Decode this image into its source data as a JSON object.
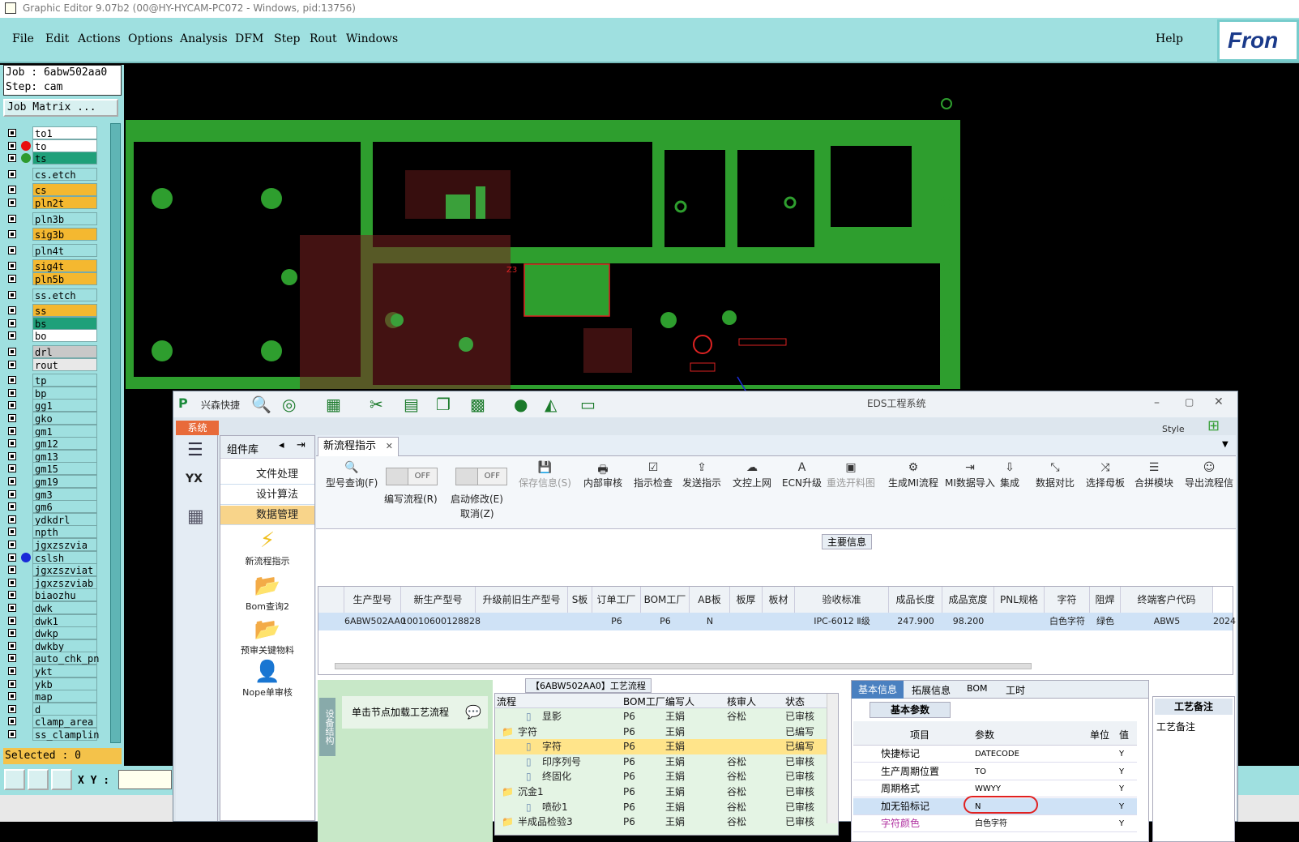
{
  "window_title": "Graphic Editor 9.07b2 (00@HY-HYCAM-PC072 - Windows, pid:13756)",
  "menu": [
    "File",
    "Edit",
    "Actions",
    "Options",
    "Analysis",
    "DFM",
    "Step",
    "Rout",
    "Windows"
  ],
  "help_label": "Help",
  "logo_text": "Fron",
  "job": {
    "job_line": "Job : 6abw502aa0",
    "step_line": "Step: cam",
    "matrix_button": "Job Matrix ..."
  },
  "layers": [
    {
      "name": "to1",
      "bg": "#ffffff"
    },
    {
      "name": "to",
      "bg": "#ffffff",
      "dot": "#e81010"
    },
    {
      "name": "ts",
      "bg": "#1fa07a",
      "dot": "#2e9a2e"
    },
    {
      "name": "cs.etch",
      "bg": "#9fe0e0"
    },
    {
      "name": "cs",
      "bg": "#f4b830"
    },
    {
      "name": "pln2t",
      "bg": "#f4b830"
    },
    {
      "name": "pln3b",
      "bg": "#9fe0e0"
    },
    {
      "name": "sig3b",
      "bg": "#f4b830"
    },
    {
      "name": "pln4t",
      "bg": "#9fe0e0"
    },
    {
      "name": "sig4t",
      "bg": "#f4b830"
    },
    {
      "name": "pln5b",
      "bg": "#f4b830"
    },
    {
      "name": "ss.etch",
      "bg": "#9fe0e0"
    },
    {
      "name": "ss",
      "bg": "#f4b830"
    },
    {
      "name": "bs",
      "bg": "#1fa07a"
    },
    {
      "name": "bo",
      "bg": "#ffffff"
    },
    {
      "name": "drl",
      "bg": "#c8c8c8"
    },
    {
      "name": "rout",
      "bg": "#e8e8e8"
    },
    {
      "name": "tp",
      "bg": "#9fe0e0"
    },
    {
      "name": "bp",
      "bg": "#9fe0e0"
    },
    {
      "name": "gg1",
      "bg": "#9fe0e0"
    },
    {
      "name": "gko",
      "bg": "#9fe0e0"
    },
    {
      "name": "gm1",
      "bg": "#9fe0e0"
    },
    {
      "name": "gm12",
      "bg": "#9fe0e0"
    },
    {
      "name": "gm13",
      "bg": "#9fe0e0"
    },
    {
      "name": "gm15",
      "bg": "#9fe0e0"
    },
    {
      "name": "gm19",
      "bg": "#9fe0e0"
    },
    {
      "name": "gm3",
      "bg": "#9fe0e0"
    },
    {
      "name": "gm6",
      "bg": "#9fe0e0"
    },
    {
      "name": "ydkdrl",
      "bg": "#9fe0e0"
    },
    {
      "name": "npth",
      "bg": "#9fe0e0"
    },
    {
      "name": "jgxzszvia",
      "bg": "#9fe0e0"
    },
    {
      "name": "cslsh",
      "bg": "#9fe0e0",
      "dot": "#1a2ad8"
    },
    {
      "name": "jgxzszviat",
      "bg": "#9fe0e0"
    },
    {
      "name": "jgxzszviab",
      "bg": "#9fe0e0"
    },
    {
      "name": "biaozhu",
      "bg": "#9fe0e0"
    },
    {
      "name": "dwk",
      "bg": "#9fe0e0"
    },
    {
      "name": "dwk1",
      "bg": "#9fe0e0"
    },
    {
      "name": "dwkp",
      "bg": "#9fe0e0"
    },
    {
      "name": "dwkby",
      "bg": "#9fe0e0"
    },
    {
      "name": "auto_chk_pn",
      "bg": "#9fe0e0"
    },
    {
      "name": "ykt",
      "bg": "#9fe0e0"
    },
    {
      "name": "ykb",
      "bg": "#9fe0e0"
    },
    {
      "name": "map",
      "bg": "#9fe0e0"
    },
    {
      "name": "d",
      "bg": "#9fe0e0"
    },
    {
      "name": "clamp_area",
      "bg": "#9fe0e0"
    },
    {
      "name": "ss_clamplin",
      "bg": "#9fe0e0"
    }
  ],
  "selected_text": "Selected : 0",
  "xy_label": "X Y :",
  "pcb_label": "Z3",
  "eds": {
    "app_name": "兴森快捷",
    "title": "EDS工程系统",
    "style_label": "Style",
    "system_tab": "系统",
    "component_lib": "组件库",
    "components": [
      "文件处理",
      "设计算法",
      "数据管理"
    ],
    "big_items": [
      "新流程指示",
      "Bom查询2",
      "预审关键物料",
      "Nope单审核"
    ],
    "doc_tab": "新流程指示",
    "ribbon": [
      {
        "label": "型号查询(F)",
        "icon": "🔍"
      },
      {
        "label": "保存信息(S)",
        "icon": "💾",
        "disabled": true
      },
      {
        "label": "内部审核",
        "icon": "🖶"
      },
      {
        "label": "指示检查",
        "icon": "☑"
      },
      {
        "label": "发送指示",
        "icon": "⇪"
      },
      {
        "label": "文控上网",
        "icon": "☁"
      },
      {
        "label": "ECN升级",
        "icon": "A"
      },
      {
        "label": "重选开料图",
        "icon": "▣",
        "disabled": true
      },
      {
        "label": "生成MI流程",
        "icon": "⚙"
      },
      {
        "label": "MI数据导入",
        "icon": "⇥"
      },
      {
        "label": "集成",
        "icon": "⇩"
      },
      {
        "label": "数据对比",
        "icon": "⤡"
      },
      {
        "label": "选择母板",
        "icon": "⤨"
      },
      {
        "label": "合拼模块",
        "icon": "☰"
      },
      {
        "label": "导出流程信",
        "icon": "☺"
      }
    ],
    "toggle1": {
      "state": "OFF",
      "label": "编写流程(R)"
    },
    "toggle2": {
      "state": "OFF",
      "label": "启动修改(E)",
      "sub": "取消(Z)"
    },
    "section_main": "主要信息",
    "grid_headers": [
      "生产型号",
      "新生产型号",
      "升级前旧生产型号",
      "S板",
      "订单工厂",
      "BOM工厂",
      "AB板",
      "板厚",
      "板材",
      "验收标准",
      "成品长度",
      "成品宽度",
      "PNL规格",
      "字符",
      "阻焊",
      "终端客户代码"
    ],
    "grid_row": [
      "6ABW502AA0",
      "10010600128828",
      "",
      "",
      "P6",
      "P6",
      "N",
      "",
      "",
      "IPC-6012 Ⅱ级",
      "247.900",
      "98.200",
      "",
      "白色字符",
      "绿色",
      "ABW5",
      "2024"
    ],
    "flow_title": "【6ABW502AA0】工艺流程",
    "side_label": "设备结构",
    "node_hint": "单击节点加载工艺流程",
    "flow_headers": [
      "流程",
      "BOM工厂",
      "编写人",
      "核审人",
      "状态"
    ],
    "flow_rows": [
      {
        "name": "显影",
        "bom": "P6",
        "writer": "王娟",
        "reviewer": "谷松",
        "status": "已审核",
        "indent": 2
      },
      {
        "name": "字符",
        "bom": "P6",
        "writer": "王娟",
        "reviewer": "",
        "status": "已编写",
        "indent": 1,
        "folder": true
      },
      {
        "name": "字符",
        "bom": "P6",
        "writer": "王娟",
        "reviewer": "",
        "status": "已编写",
        "indent": 2,
        "selected": true
      },
      {
        "name": "印序列号",
        "bom": "P6",
        "writer": "王娟",
        "reviewer": "谷松",
        "status": "已审核",
        "indent": 2
      },
      {
        "name": "终固化",
        "bom": "P6",
        "writer": "王娟",
        "reviewer": "谷松",
        "status": "已审核",
        "indent": 2
      },
      {
        "name": "沉金1",
        "bom": "P6",
        "writer": "王娟",
        "reviewer": "谷松",
        "status": "已审核",
        "indent": 1,
        "folder": true
      },
      {
        "name": "喷砂1",
        "bom": "P6",
        "writer": "王娟",
        "reviewer": "谷松",
        "status": "已审核",
        "indent": 2
      },
      {
        "name": "半成品检验3",
        "bom": "P6",
        "writer": "王娟",
        "reviewer": "谷松",
        "status": "已审核",
        "indent": 1,
        "folder": true
      }
    ],
    "info_tabs": [
      "基本信息",
      "拓展信息",
      "BOM",
      "工时"
    ],
    "basic_params": "基本参数",
    "param_headers": [
      "项目",
      "参数",
      "单位",
      "值"
    ],
    "params": [
      {
        "item": "快捷标记",
        "value": "DATECODE",
        "unit": "",
        "flag": "Y"
      },
      {
        "item": "生产周期位置",
        "value": "TO",
        "unit": "",
        "flag": "Y"
      },
      {
        "item": "周期格式",
        "value": "WWYY",
        "unit": "",
        "flag": "Y"
      },
      {
        "item": "加无铅标记",
        "value": "N",
        "unit": "",
        "flag": "Y"
      },
      {
        "item": "字符颜色",
        "value": "白色字符",
        "unit": "",
        "flag": "Y"
      }
    ],
    "remarks_tab": "工艺备注",
    "remarks_label": "工艺备注"
  }
}
